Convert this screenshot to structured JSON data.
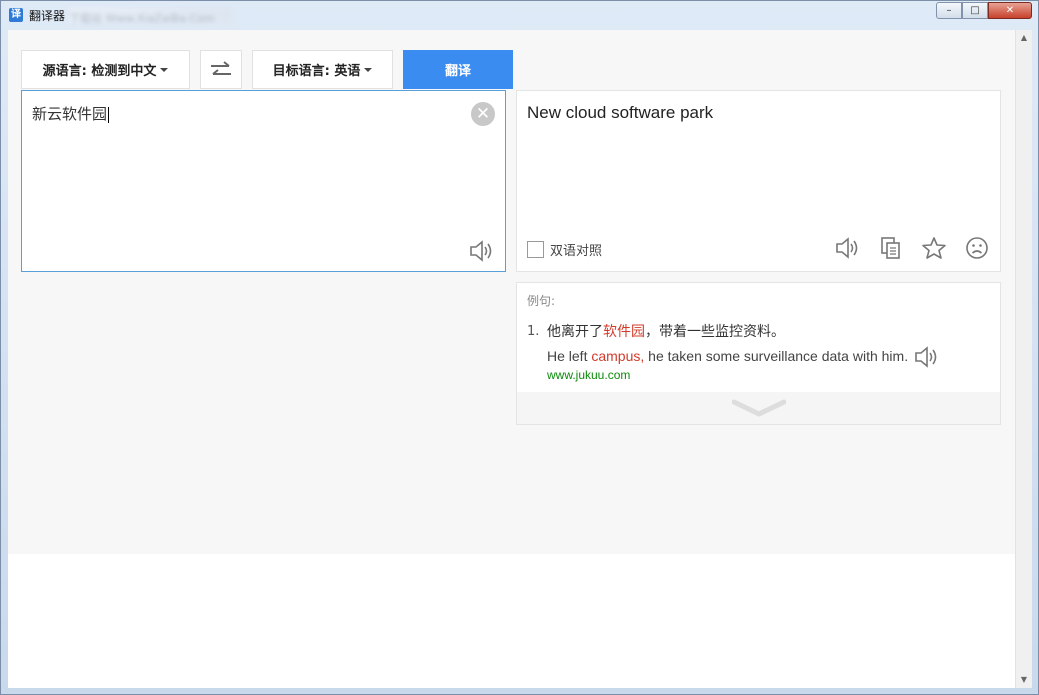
{
  "window": {
    "title": "翻译器",
    "title_suffix_blurred": "下载站 Www.XiaZaiBa.Com",
    "minimize": "–",
    "maximize": "□",
    "close": "✕"
  },
  "toolbar": {
    "source_language": "源语言: 检测到中文",
    "swap_label": "⇄",
    "target_language": "目标语言: 英语",
    "translate_button": "翻译"
  },
  "source": {
    "text": "新云软件园",
    "clear": "✕"
  },
  "result": {
    "text": "New cloud software park",
    "bilingual_label": "双语对照",
    "bilingual_checked": false
  },
  "examples": {
    "label": "例句:",
    "items": [
      {
        "number": "1.",
        "cn_before": "他离开了",
        "cn_highlight": "软件园",
        "cn_after": "，带着一些监控资料。",
        "en_before": "He left ",
        "en_highlight": "campus,",
        "en_after": " he taken some surveillance data with him.",
        "source": "www.jukuu.com"
      }
    ]
  },
  "colors": {
    "accent": "#3b8cf0",
    "highlight": "#d23b2b",
    "source_link": "#0b8a0b"
  }
}
